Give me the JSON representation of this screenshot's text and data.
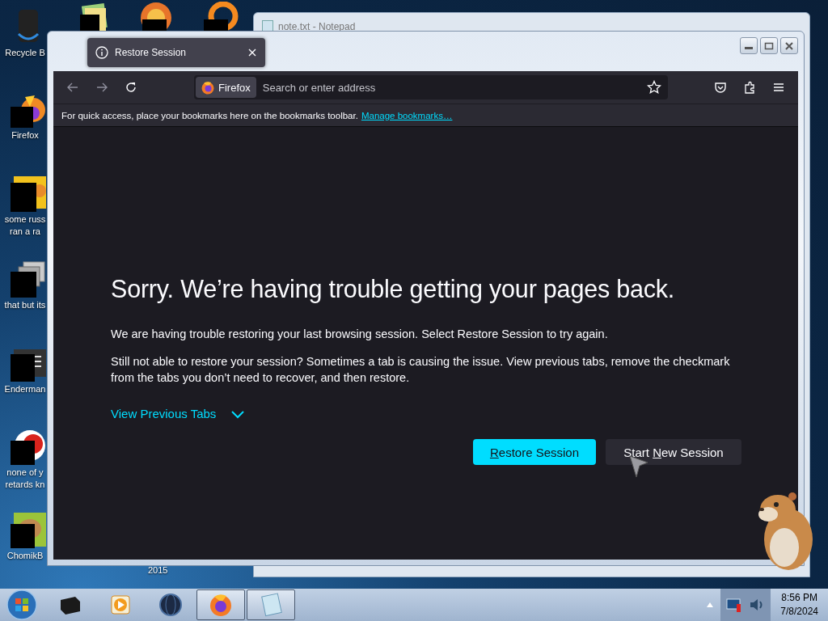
{
  "desktop": {
    "icons": [
      {
        "kind": "bin",
        "lines": [
          "Recycle B"
        ]
      },
      {
        "kind": "firefox",
        "lines": [
          "Firefox"
        ]
      },
      {
        "kind": "yellow-app",
        "lines": [
          "some russ",
          "ran a ra"
        ]
      },
      {
        "kind": "stack",
        "lines": [
          "that but its"
        ]
      },
      {
        "kind": "terminal",
        "lines": [
          "Enderman"
        ]
      },
      {
        "kind": "red-ring",
        "lines": [
          "none of y",
          "retards kn"
        ]
      },
      {
        "kind": "hamster",
        "lines": [
          "ChomikB"
        ]
      }
    ],
    "stray_label": "2015"
  },
  "notepad_window": {
    "title": "note.txt - Notepad"
  },
  "browser": {
    "tabs": [
      {
        "label": "Restore Session",
        "selected": true
      }
    ],
    "identity": "Firefox",
    "address": {
      "placeholder": "Search or enter address"
    },
    "bookmarks_bar": {
      "message": "For quick access, place your bookmarks here on the bookmarks toolbar.",
      "link": "Manage bookmarks…"
    },
    "page": {
      "heading": "Sorry. We’re having trouble getting your pages back.",
      "paragraphs": [
        "We are having trouble restoring your last browsing session. Select Restore Session to try again.",
        "Still not able to restore your session? Sometimes a tab is causing the issue. View previous tabs, remove the checkmark from the tabs you don’t need to recover, and then restore."
      ],
      "toggle": {
        "label": "View Previous Tabs",
        "expanded": false
      },
      "buttons": [
        {
          "kind": "primary",
          "segments": [
            {
              "text": "R",
              "underlined": true
            },
            {
              "text": "estore Session",
              "underlined": false
            }
          ]
        },
        {
          "kind": "secondary",
          "segments": [
            {
              "text": "Start ",
              "underlined": false
            },
            {
              "text": "N",
              "underlined": true
            },
            {
              "text": "ew Session",
              "underlined": false
            }
          ]
        }
      ]
    }
  },
  "taskbar": {
    "items": [
      {
        "kind": "drive",
        "active": false
      },
      {
        "kind": "media",
        "active": false
      },
      {
        "kind": "globe",
        "active": false
      },
      {
        "kind": "firefox",
        "active": true
      },
      {
        "kind": "notepad",
        "active": true
      }
    ],
    "clock": {
      "time": "8:56 PM",
      "date": "7/8/2024"
    }
  }
}
